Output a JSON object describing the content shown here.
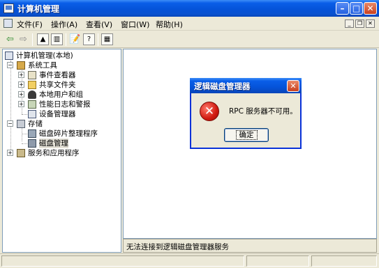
{
  "window": {
    "title": "计算机管理",
    "menu": [
      "文件(F)",
      "操作(A)",
      "查看(V)",
      "窗口(W)",
      "帮助(H)"
    ]
  },
  "toolbar": {
    "icons": [
      "back-arrow-icon",
      "forward-arrow-icon",
      "up-folder-icon",
      "show-hide-tree-icon",
      "properties-icon",
      "help-icon",
      "export-icon"
    ]
  },
  "tree": {
    "root": "计算机管理(本地)",
    "system_tools": "系统工具",
    "event_viewer": "事件查看器",
    "shared_folders": "共享文件夹",
    "local_users": "本地用户和组",
    "perf_logs": "性能日志和警报",
    "device_manager": "设备管理器",
    "storage": "存储",
    "defrag": "磁盘碎片整理程序",
    "disk_mgmt": "磁盘管理",
    "services": "服务和应用程序"
  },
  "right_pane": {
    "status_text": "无法连接到逻辑磁盘管理器服务"
  },
  "dialog": {
    "title": "逻辑磁盘管理器",
    "message": "RPC 服务器不可用。",
    "ok_label": "确定"
  },
  "colors": {
    "titlebar_blue": "#0553D9",
    "window_face": "#ECE9D8",
    "error_red": "#D01A10"
  }
}
